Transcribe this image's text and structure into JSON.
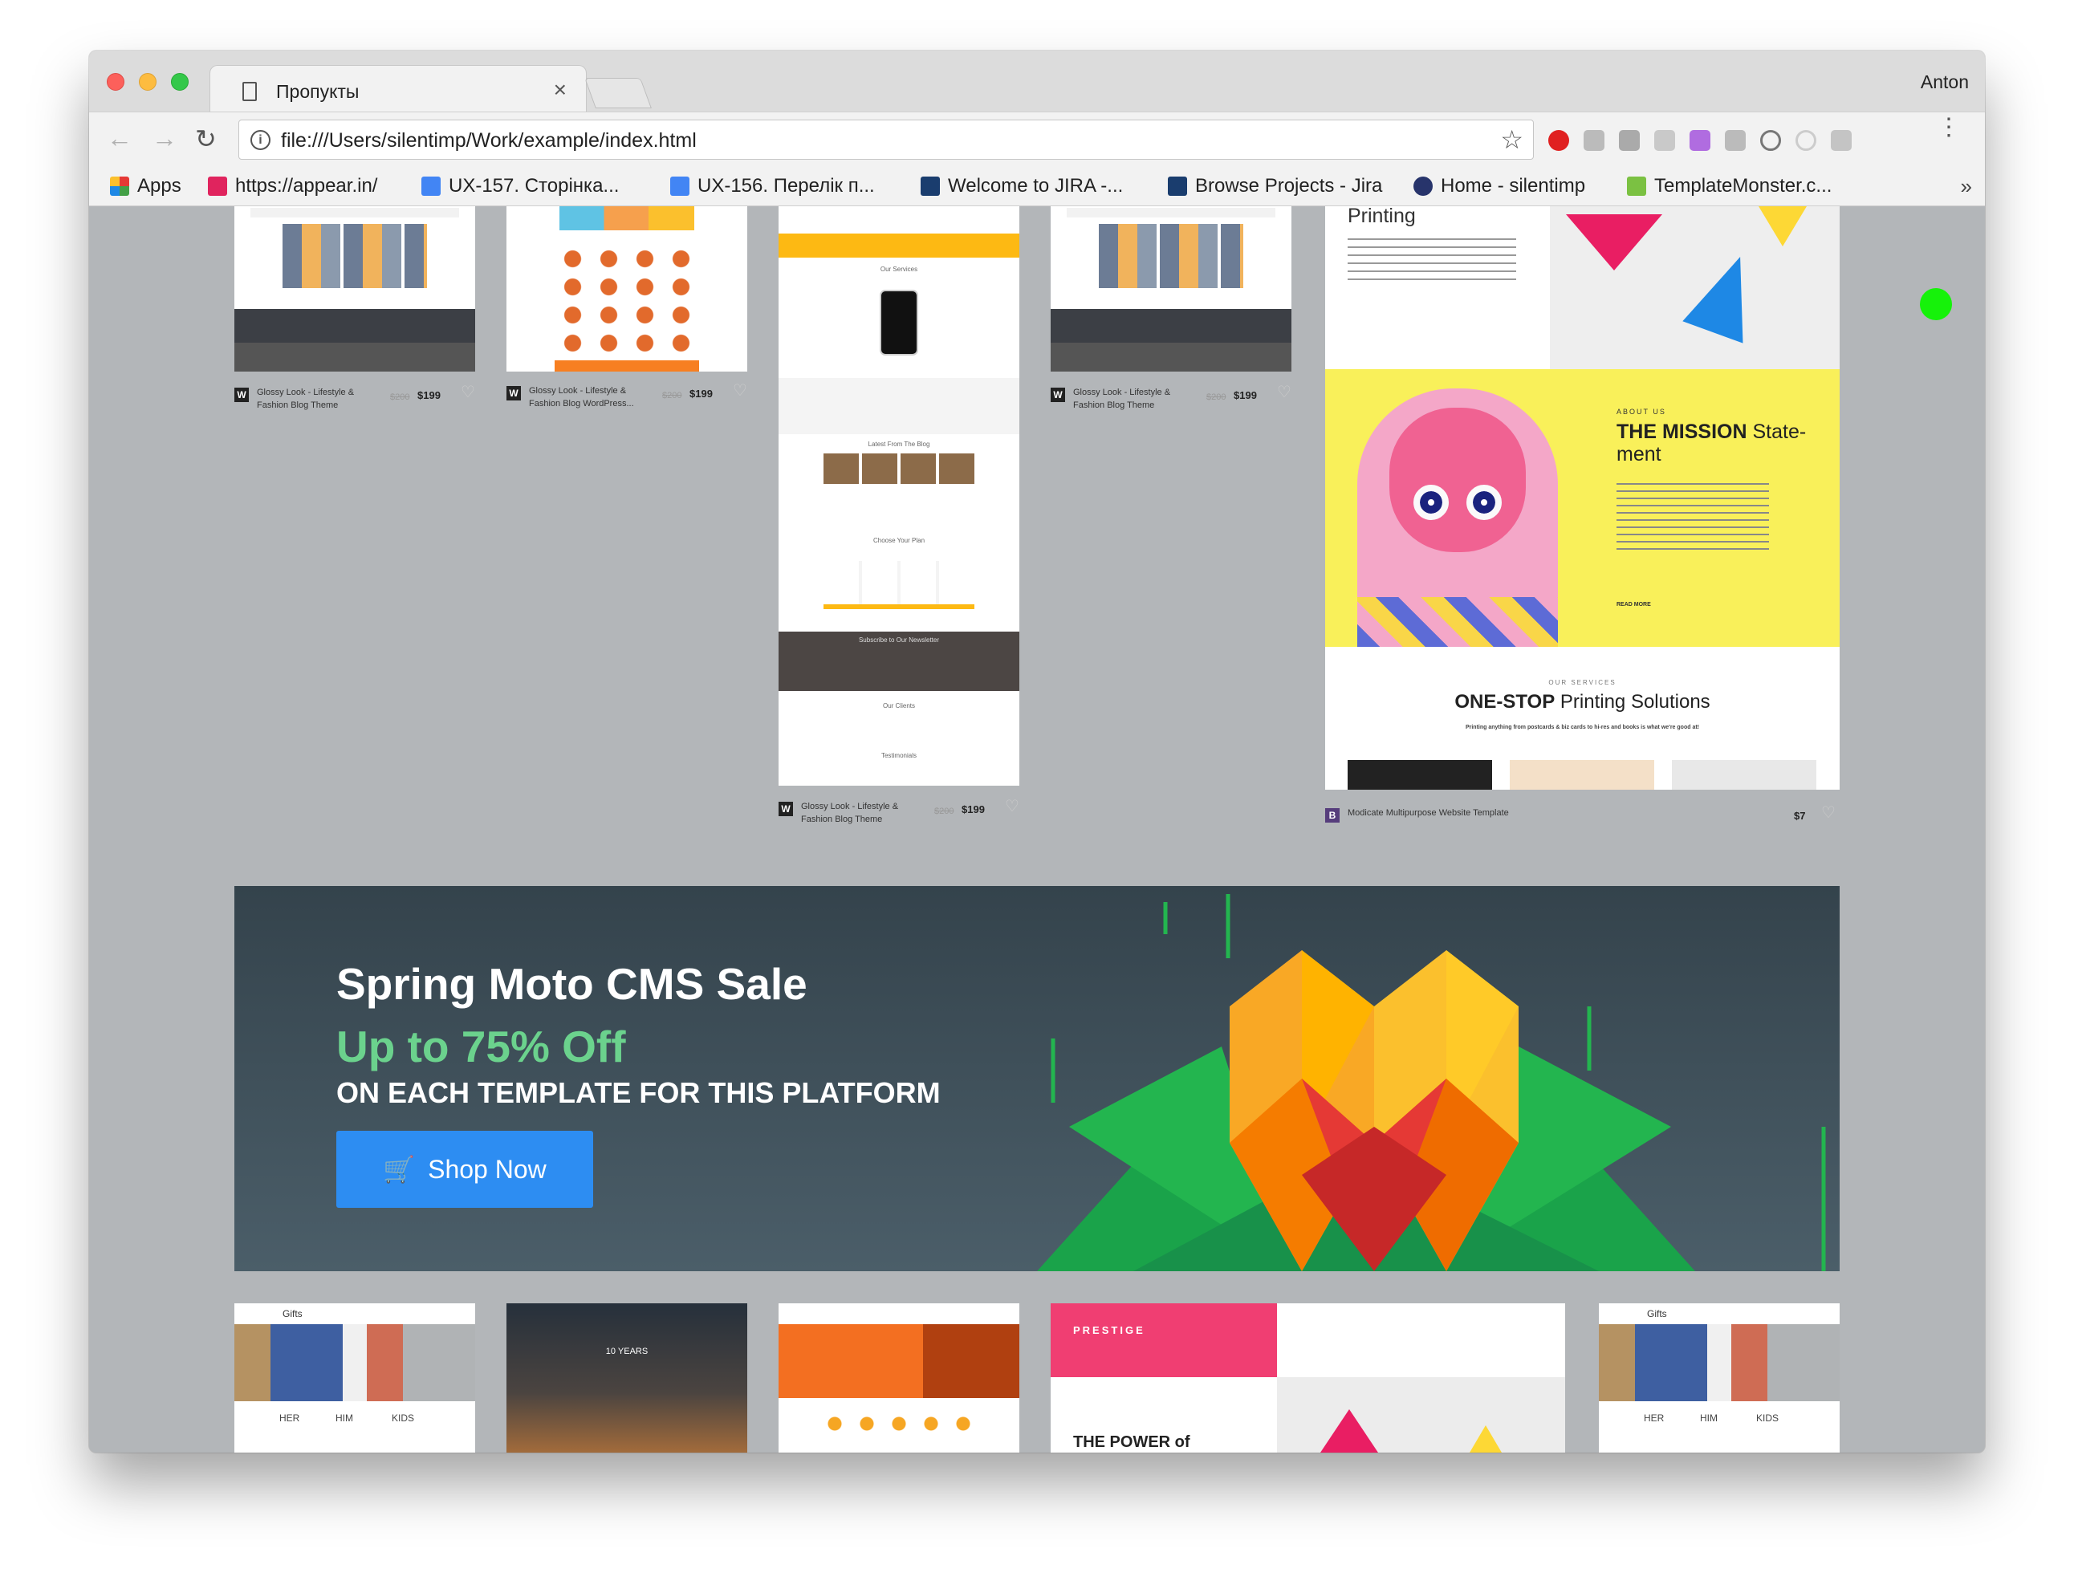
{
  "window": {
    "profile": "Anton"
  },
  "tab": {
    "title": "Пропукты",
    "close": "×"
  },
  "toolbar": {
    "back": "←",
    "forward": "→",
    "reload": "↻",
    "url": "file:///Users/silentimp/Work/example/index.html",
    "star": "☆",
    "menu": "⋮"
  },
  "bookmarks": {
    "items": [
      {
        "label": "Apps",
        "icon": "apps-grid-icon"
      },
      {
        "label": "https://appear.in/",
        "icon": "appear-in-icon"
      },
      {
        "label": "UX-157. Сторінка...",
        "icon": "google-docs-icon"
      },
      {
        "label": "UX-156. Перелік п...",
        "icon": "google-docs-icon"
      },
      {
        "label": "Welcome to JIRA -...",
        "icon": "jira-icon"
      },
      {
        "label": "Browse Projects - Jira",
        "icon": "jira-icon"
      },
      {
        "label": "Home - silentimp",
        "icon": "home-icon"
      },
      {
        "label": "TemplateMonster.c...",
        "icon": "templatemonster-icon"
      }
    ],
    "more": "»"
  },
  "products": [
    {
      "name": "Glossy Look - Lifestyle & Fashion Blog Theme",
      "old": "$200",
      "price": "$199",
      "logo": "W"
    },
    {
      "name": "Glossy Look - Lifestyle & Fashion Blog WordPress...",
      "old": "$200",
      "price": "$199",
      "logo": "W"
    },
    {
      "name": "Glossy Look - Lifestyle & Fashion Blog Theme",
      "old": "$200",
      "price": "$199",
      "logo": "W"
    },
    {
      "name": "Glossy Look - Lifestyle & Fashion Blog Theme",
      "old": "$200",
      "price": "$199",
      "logo": "W"
    },
    {
      "name": "Modicate Multipurpose Website Template",
      "old": "",
      "price": "$7",
      "logo": "B"
    }
  ],
  "featured": {
    "printing": "Printing",
    "about_us": "ABOUT US",
    "mission_bold": "THE MISSION",
    "mission_rest": "State-ment",
    "our_services": "OUR SERVICES",
    "onestop_bold": "ONE-STOP",
    "onestop_rest": "Printing Solutions",
    "onestop_sub": "Printing anything from postcards & biz cards to hi-res and books is what we're good at!",
    "read_more": "READ MORE"
  },
  "preview": {
    "our_services": "Our Services",
    "latest_blog": "Latest From The Blog",
    "choose_plan": "Choose Your Plan",
    "subscribe": "Subscribe to Our Newsletter",
    "our_clients": "Our Clients",
    "testimonials": "Testimonials",
    "years": "10 YEARS",
    "prestige": "PRESTIGE",
    "power": "THE POWER of",
    "gifts": "Gifts",
    "her": "HER",
    "him": "HIM",
    "kids": "KIDS"
  },
  "banner": {
    "title": "Spring Moto CMS Sale",
    "offer": "Up to 75% Off",
    "subtitle": "ON EACH TEMPLATE FOR THIS PLATFORM",
    "button": "Shop Now"
  },
  "colors": {
    "accent_green": "#6bd28d",
    "button_blue": "#2d8df2",
    "banner_bg": "#3a4a54",
    "status_dot": "#16f20a"
  }
}
